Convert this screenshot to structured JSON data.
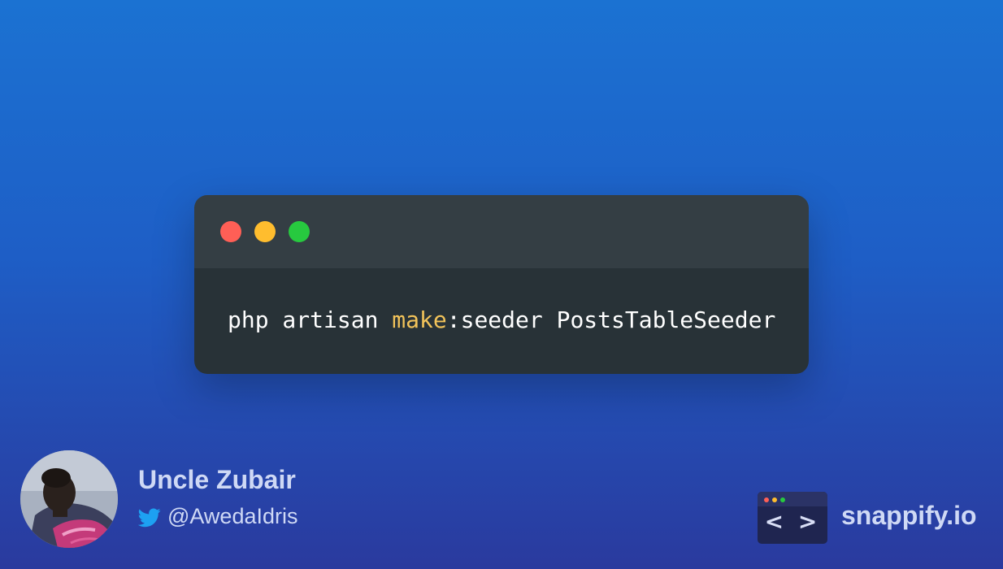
{
  "colors": {
    "background_top": "#1b72d2",
    "background_bottom": "#2a3a9e",
    "titlebar": "#343e44",
    "code_background": "#283237",
    "code_text": "#ffffff",
    "code_keyword": "#f2c35a",
    "dot_red": "#ff5f56",
    "dot_yellow": "#ffbd2e",
    "dot_green": "#27c93f",
    "twitter": "#1da1f2",
    "footer_text": "#cfd9f5"
  },
  "code_window": {
    "window_buttons": [
      {
        "name": "close",
        "color": "#ff5f56"
      },
      {
        "name": "minimize",
        "color": "#ffbd2e"
      },
      {
        "name": "maximize",
        "color": "#27c93f"
      }
    ],
    "code": {
      "prefix": "php artisan ",
      "keyword": "make",
      "suffix": ":seeder PostsTableSeeder"
    }
  },
  "author": {
    "avatar_icon": "avatar-photo",
    "name": "Uncle Zubair",
    "twitter_icon": "twitter-bird-icon",
    "handle": "@AwedaIdris"
  },
  "brand": {
    "logo_icon": "code-window-logo-icon",
    "logo_text": "< >",
    "name": "snappify.io"
  }
}
